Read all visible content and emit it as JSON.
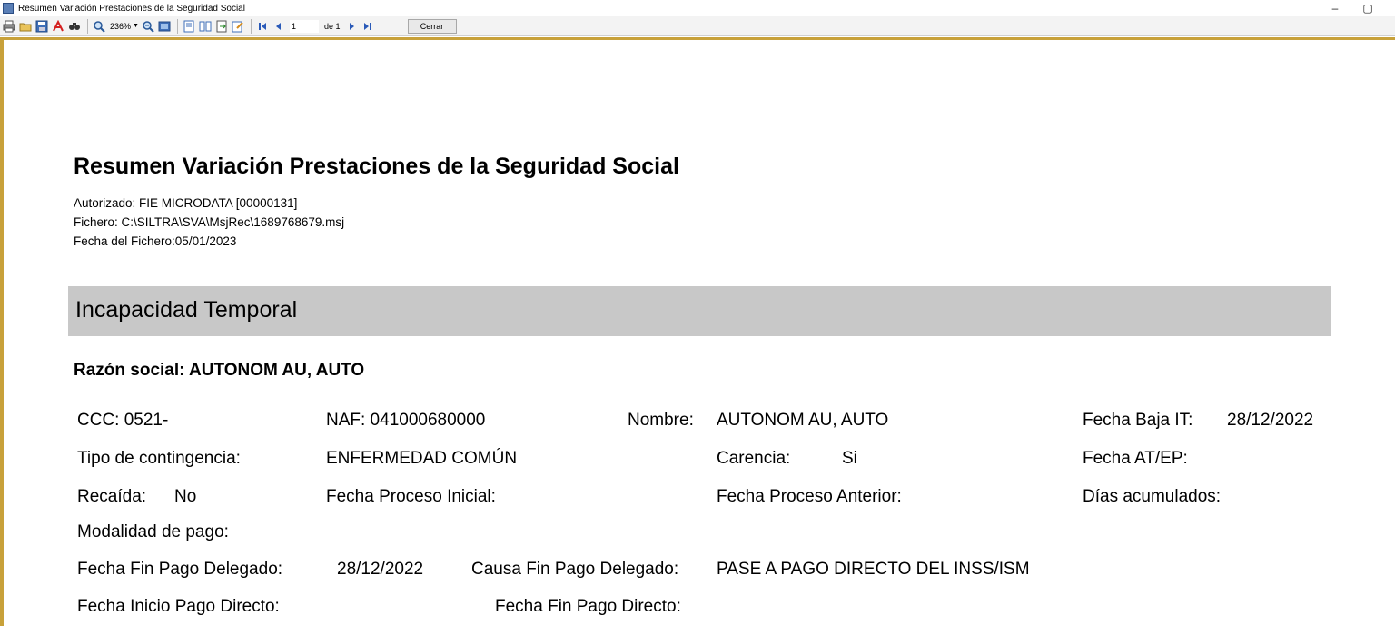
{
  "window": {
    "title": "Resumen Variación Prestaciones de la Seguridad Social",
    "minimize": "–",
    "restore": "▢"
  },
  "toolbar": {
    "zoom": "236%",
    "page_current": "1",
    "page_of": "de 1",
    "close_label": "Cerrar",
    "icons": [
      "print-icon",
      "open-icon",
      "save-icon",
      "pdf-icon",
      "find-icon",
      "zoom-in-icon",
      "zoom-out-icon",
      "single-page-icon",
      "page-layout-icon",
      "two-page-icon",
      "export-icon",
      "edit-icon",
      "first-page-icon",
      "prev-page-icon",
      "next-page-icon",
      "last-page-icon"
    ]
  },
  "report": {
    "title": "Resumen Variación Prestaciones de la Seguridad Social",
    "autorizado": "Autorizado: FIE MICRODATA [00000131]",
    "fichero": "Fichero: C:\\SILTRA\\SVA\\MsjRec\\1689768679.msj",
    "fecha_fichero": "Fecha del Fichero:05/01/2023",
    "section": "Incapacidad Temporal",
    "razon_social": "Razón social:  AUTONOM AU, AUTO",
    "fields": {
      "ccc": "CCC:  0521-",
      "naf": "NAF:  041000680000",
      "nombre_label": "Nombre:",
      "nombre_value": "AUTONOM AU, AUTO",
      "fecha_baja_label": "Fecha Baja IT:",
      "fecha_baja_value": "28/12/2022",
      "tipo_contingencia_label": "Tipo de contingencia:",
      "tipo_contingencia_value": "ENFERMEDAD COMÚN",
      "carencia_label": "Carencia:",
      "carencia_value": "Si",
      "fecha_atep_label": "Fecha AT/EP:",
      "recaida_label": "Recaída:",
      "recaida_value": "No",
      "fecha_proceso_inicial_label": "Fecha Proceso Inicial:",
      "fecha_proceso_anterior_label": "Fecha Proceso Anterior:",
      "dias_acumulados_label": "Días acumulados:",
      "modalidad_pago_label": "Modalidad de pago:",
      "fecha_fin_pago_delegado_label": "Fecha Fin Pago Delegado:",
      "fecha_fin_pago_delegado_value": "28/12/2022",
      "causa_fin_pago_delegado_label": "Causa Fin Pago Delegado:",
      "causa_fin_pago_delegado_value": "PASE A PAGO DIRECTO DEL INSS/ISM",
      "fecha_inicio_pago_directo_label": "Fecha Inicio Pago Directo:",
      "fecha_fin_pago_directo_label": "Fecha Fin Pago Directo:"
    }
  },
  "colors": {
    "frame": "#c8a13a",
    "section_bg": "#c8c8c8"
  }
}
